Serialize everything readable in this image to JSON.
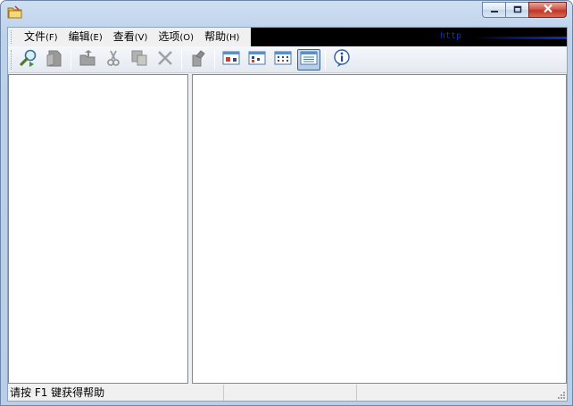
{
  "titlebar": {
    "title": "",
    "icon": "folder-icon",
    "controls": [
      "minimize-icon",
      "maximize-icon",
      "close-icon"
    ]
  },
  "menubar": {
    "items": [
      {
        "label": "文件",
        "accel": "(F)"
      },
      {
        "label": "编辑",
        "accel": "(E)"
      },
      {
        "label": "查看",
        "accel": "(V)"
      },
      {
        "label": "选项",
        "accel": "(O)"
      },
      {
        "label": "帮助",
        "accel": "(H)"
      }
    ],
    "banner_text": "http"
  },
  "toolbar": {
    "buttons": [
      {
        "icon": "search-icon",
        "enabled": true
      },
      {
        "icon": "document-icon",
        "enabled": false
      },
      {
        "icon": "folder-up-icon",
        "enabled": false
      },
      {
        "icon": "cut-icon",
        "enabled": false
      },
      {
        "icon": "copy-icon",
        "enabled": false
      },
      {
        "icon": "delete-icon",
        "enabled": false
      },
      {
        "icon": "properties-icon",
        "enabled": false
      },
      {
        "icon": "large-icons-view-icon",
        "enabled": true
      },
      {
        "icon": "small-icons-view-icon",
        "enabled": true
      },
      {
        "icon": "list-view-icon",
        "enabled": true
      },
      {
        "icon": "details-view-icon",
        "enabled": true,
        "pressed": true
      },
      {
        "icon": "info-icon",
        "enabled": true
      }
    ]
  },
  "statusbar": {
    "message": "请按 F1 键获得帮助",
    "panel2": "",
    "panel3": ""
  },
  "colors": {
    "menubar_background": "#000000",
    "banner_text": "#1a2fb0",
    "pane_border": "#828790",
    "window_frame": "#bcd1ea"
  }
}
